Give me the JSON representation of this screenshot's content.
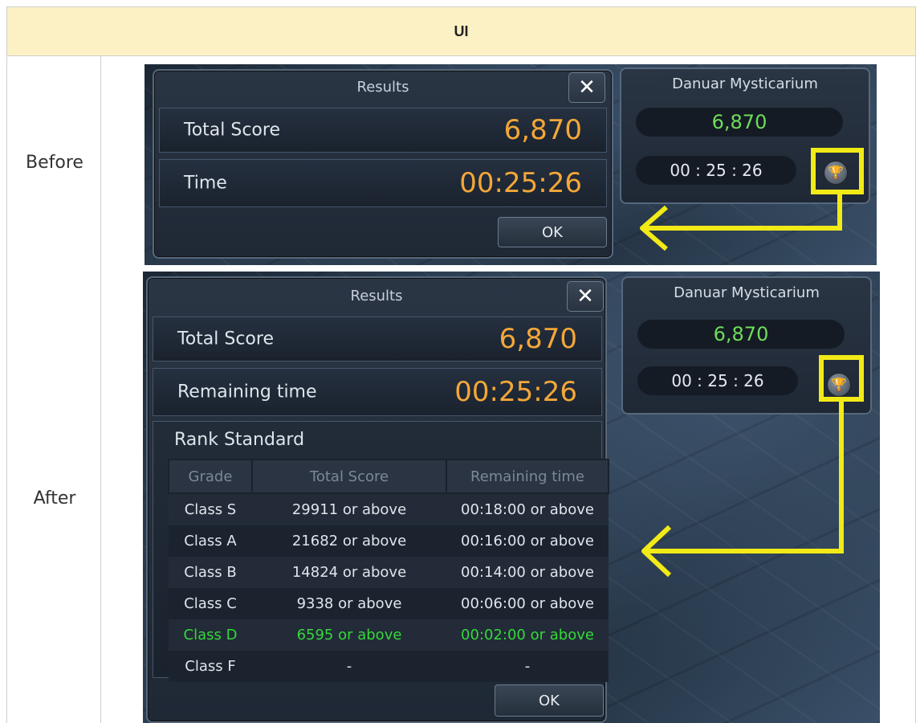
{
  "header": {
    "title": "UI"
  },
  "rows": [
    {
      "label": "Before"
    },
    {
      "label": "After"
    }
  ],
  "before": {
    "window_title": "Results",
    "close_glyph": "✕",
    "score_label": "Total Score",
    "score_value": "6,870",
    "time_label": "Time",
    "time_value": "00:25:26",
    "ok_label": "OK",
    "side": {
      "title": "Danuar Mysticarium",
      "score": "6,870",
      "time": "00 : 25 : 26"
    }
  },
  "after": {
    "window_title": "Results",
    "close_glyph": "✕",
    "score_label": "Total Score",
    "score_value": "6,870",
    "time_label": "Remaining time",
    "time_value": "00:25:26",
    "rank_title": "Rank Standard",
    "columns": [
      "Grade",
      "Total Score",
      "Remaining time"
    ],
    "grades": [
      {
        "grade": "Class S",
        "score": "29911 or above",
        "time": "00:18:00 or above"
      },
      {
        "grade": "Class A",
        "score": "21682 or above",
        "time": "00:16:00 or above"
      },
      {
        "grade": "Class B",
        "score": "14824 or above",
        "time": "00:14:00 or above"
      },
      {
        "grade": "Class C",
        "score": "9338 or above",
        "time": "00:06:00 or above"
      },
      {
        "grade": "Class D",
        "score": "6595 or above",
        "time": "00:02:00 or above"
      },
      {
        "grade": "Class F",
        "score": "-",
        "time": "-"
      }
    ],
    "ok_label": "OK",
    "side": {
      "title": "Danuar Mysticarium",
      "score": "6,870",
      "time": "00 : 25 : 26"
    }
  },
  "icons": {
    "trophy": "trophy-icon",
    "close": "close-icon",
    "arrow": "arrow-left-icon"
  },
  "colors": {
    "header_bg": "#fcf1c5",
    "highlight": "#f2ea17",
    "score_orange": "#f3a738",
    "achieved_green": "#35d83a"
  }
}
